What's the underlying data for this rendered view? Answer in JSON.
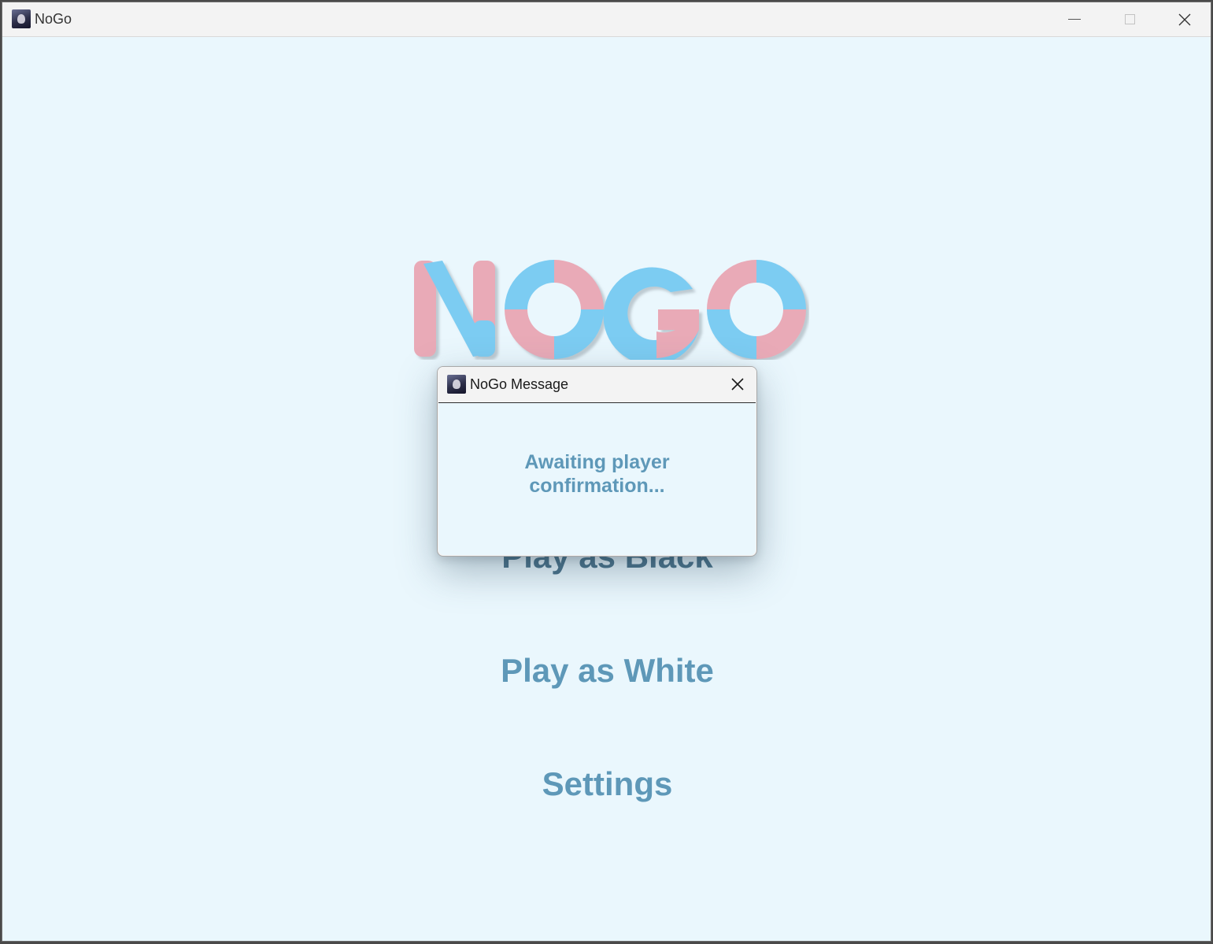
{
  "window": {
    "title": "NoGo"
  },
  "logo": {
    "text": "NOGO",
    "colors": {
      "pink": "#e9aab7",
      "blue": "#7cccf2"
    }
  },
  "menu": {
    "play_black": "Play as Black",
    "play_white": "Play as White",
    "settings": "Settings"
  },
  "dialog": {
    "title": "NoGo Message",
    "message_line1": "Awaiting player",
    "message_line2": "confirmation..."
  },
  "icons": {
    "app": "anime-avatar-icon",
    "minimize": "minimize-icon",
    "maximize": "maximize-icon",
    "close": "close-icon"
  }
}
